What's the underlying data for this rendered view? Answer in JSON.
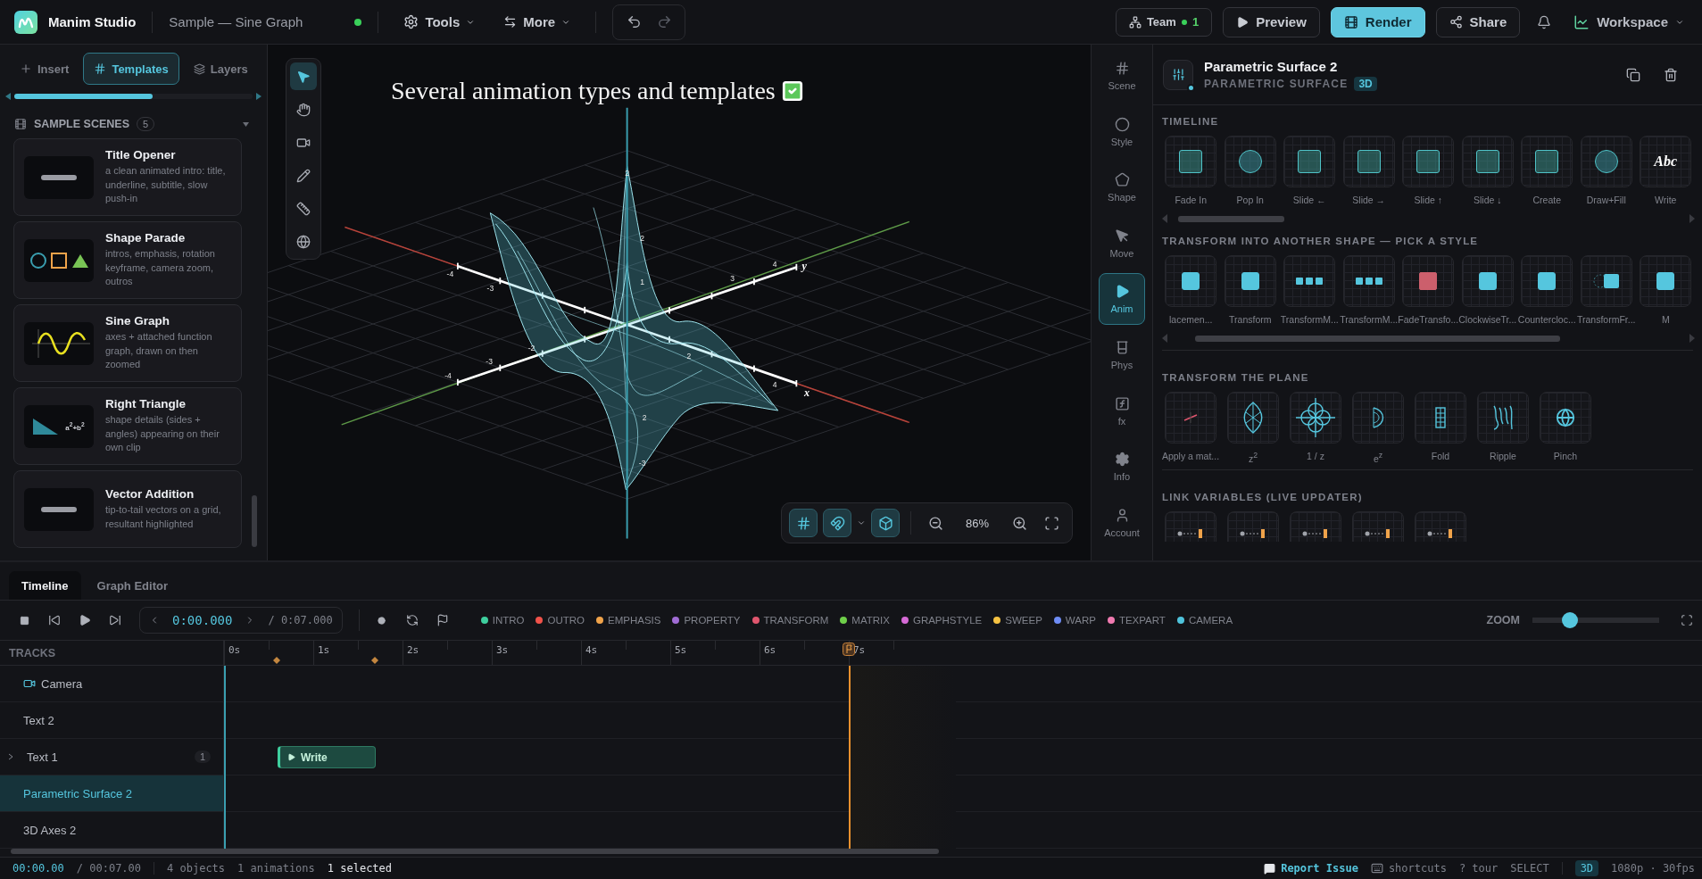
{
  "app": {
    "name": "Manim Studio",
    "project": "Sample — Sine Graph",
    "saved": true
  },
  "toolbar": {
    "menus": [
      {
        "label": "Tools",
        "kind": "gear"
      },
      {
        "label": "More",
        "kind": "swap"
      }
    ],
    "undo_disabled": false,
    "redo_disabled": true
  },
  "top_actions": {
    "team": {
      "label": "Team",
      "count": "1"
    },
    "buttons": [
      {
        "label": "Preview",
        "kind": "preview"
      },
      {
        "label": "Render",
        "kind": "render"
      },
      {
        "label": "Share",
        "kind": "share"
      }
    ],
    "workspace": "Workspace"
  },
  "left_panel": {
    "tabs": [
      {
        "label": "Insert",
        "kind": "insert",
        "selected": false
      },
      {
        "label": "Templates",
        "kind": "templates",
        "selected": true
      },
      {
        "label": "Layers",
        "kind": "layers",
        "selected": false
      }
    ],
    "section": {
      "title": "SAMPLE SCENES",
      "count": "5",
      "expanded": true
    },
    "scenes": [
      {
        "title": "Title Opener",
        "description": "a clean animated intro: title, underline, subtitle, slow push-in",
        "kind": "bar"
      },
      {
        "title": "Shape Parade",
        "description": "intros, emphasis, rotation keyframe, camera zoom, outros",
        "kind": "shapes"
      },
      {
        "title": "Sine Graph",
        "description": "axes + attached function graph, drawn on then zoomed",
        "kind": "sine"
      },
      {
        "title": "Right Triangle",
        "description": "shape details (sides + angles) appearing on their own clip",
        "kind": "triangle",
        "thumb_text": "a$^{2}$+b$^{2}$"
      },
      {
        "title": "Vector Addition",
        "description": "tip-to-tail vectors on a grid, resultant highlighted",
        "kind": "bar"
      }
    ]
  },
  "viewport": {
    "heading": "Several animation types and templates",
    "tools": [
      {
        "kind": "pointer",
        "selected": true
      },
      {
        "kind": "hand",
        "selected": false
      },
      {
        "kind": "camera",
        "selected": false
      },
      {
        "kind": "pen",
        "selected": false
      },
      {
        "kind": "ruler",
        "selected": false
      },
      {
        "kind": "globe",
        "selected": false
      }
    ],
    "tick_labels": [
      "-4",
      "-3",
      "-4",
      "-3",
      "-2",
      "2",
      "3",
      "4",
      "4",
      "2",
      "2",
      "1",
      "2",
      "-3"
    ],
    "axis_labels": [
      "y",
      "x"
    ],
    "view_toggles": [
      {
        "kind": "grid",
        "on": true
      },
      {
        "kind": "snap",
        "on": true
      },
      {
        "kind": "cube",
        "on": true
      }
    ],
    "zoom": "86%"
  },
  "rail": [
    {
      "label": "Scene",
      "kind": "scene",
      "selected": false
    },
    {
      "label": "Style",
      "kind": "style",
      "selected": false
    },
    {
      "label": "Shape",
      "kind": "shape",
      "selected": false
    },
    {
      "label": "Move",
      "kind": "move",
      "selected": false
    },
    {
      "label": "Anim",
      "kind": "anim",
      "selected": true
    },
    {
      "label": "Phys",
      "kind": "phys",
      "selected": false
    },
    {
      "label": "fx",
      "kind": "fx",
      "selected": false
    },
    {
      "label": "Info",
      "kind": "info",
      "selected": false
    },
    {
      "label": "Account",
      "kind": "account",
      "selected": false
    }
  ],
  "inspector": {
    "title": "Parametric Surface 2",
    "type": "PARAMETRIC SURFACE",
    "badge": "3D",
    "sections": [
      {
        "title": "TIMELINE",
        "kind": "scroll",
        "tiles": [
          {
            "label": "Fade In",
            "kind": "square"
          },
          {
            "label": "Pop In",
            "kind": "circle"
          },
          {
            "label": "Slide ←",
            "kind": "square"
          },
          {
            "label": "Slide →",
            "kind": "square"
          },
          {
            "label": "Slide ↑",
            "kind": "square"
          },
          {
            "label": "Slide ↓",
            "kind": "square"
          },
          {
            "label": "Create",
            "kind": "square"
          },
          {
            "label": "Draw+Fill",
            "kind": "circle"
          },
          {
            "label": "Write",
            "kind": "text",
            "glyph": "Abc"
          }
        ]
      },
      {
        "title": "TRANSFORM INTO ANOTHER SHAPE — PICK A STYLE",
        "kind": "scroll",
        "tiles": [
          {
            "label": "lacemen...",
            "kind": "solid"
          },
          {
            "label": "Transform",
            "kind": "solid"
          },
          {
            "label": "TransformM...",
            "kind": "triple"
          },
          {
            "label": "TransformM...",
            "kind": "triple"
          },
          {
            "label": "FadeTransfo...",
            "kind": "fade"
          },
          {
            "label": "ClockwiseTr...",
            "kind": "solid"
          },
          {
            "label": "Countercloc...",
            "kind": "solid"
          },
          {
            "label": "TransformFr...",
            "kind": "ghost"
          },
          {
            "label": "M",
            "kind": "solid"
          }
        ]
      },
      {
        "title": "TRANSFORM THE PLANE",
        "kind": "plain",
        "tiles": [
          {
            "label": "Apply a mat...",
            "kind": "matrix"
          },
          {
            "label": "z$^{2}$",
            "kind": "lens"
          },
          {
            "label": "1 / z",
            "kind": "flower"
          },
          {
            "label": "e$^{z}$",
            "kind": "half"
          },
          {
            "label": "Fold",
            "kind": "fold"
          },
          {
            "label": "Ripple",
            "kind": "ripple"
          },
          {
            "label": "Pinch",
            "kind": "globe"
          }
        ]
      },
      {
        "title": "LINK VARIABLES (LIVE UPDATER)",
        "kind": "peek",
        "tiles": [
          {
            "kind": "link"
          },
          {
            "kind": "link"
          },
          {
            "kind": "link"
          },
          {
            "kind": "link"
          },
          {
            "kind": "link"
          }
        ]
      }
    ]
  },
  "timeline": {
    "tabs": [
      {
        "label": "Timeline",
        "selected": true
      },
      {
        "label": "Graph Editor",
        "selected": false
      }
    ],
    "time": "0:00.000",
    "duration": "/ 0:07.000",
    "legend": [
      {
        "label": "INTRO",
        "color": "#3ecf9e"
      },
      {
        "label": "OUTRO",
        "color": "#f0524a"
      },
      {
        "label": "EMPHASIS",
        "color": "#f0a34a"
      },
      {
        "label": "PROPERTY",
        "color": "#a06cd5"
      },
      {
        "label": "TRANSFORM",
        "color": "#e0566e"
      },
      {
        "label": "MATRIX",
        "color": "#6fcf4a"
      },
      {
        "label": "GRAPHSTYLE",
        "color": "#d66ad6"
      },
      {
        "label": "SWEEP",
        "color": "#f5c242"
      },
      {
        "label": "WARP",
        "color": "#6e8cf5"
      },
      {
        "label": "TEXPART",
        "color": "#f07ab0"
      },
      {
        "label": "CAMERA",
        "color": "#4fc3dc"
      }
    ],
    "zoom": {
      "label": "ZOOM",
      "level": 0.27
    },
    "tracks_header": "TRACKS",
    "ruler": [
      "0s",
      "1s",
      "2s",
      "3s",
      "4s",
      "5s",
      "6s",
      "7s"
    ],
    "tracks": [
      {
        "name": "Camera",
        "kind": "camera",
        "selected": false
      },
      {
        "name": "Text 2",
        "kind": "object",
        "selected": false
      },
      {
        "name": "Text 1",
        "kind": "group",
        "selected": false,
        "expanded": false,
        "count": "1",
        "clips": [
          {
            "label": "Write"
          }
        ]
      },
      {
        "name": "Parametric Surface 2",
        "kind": "object",
        "selected": true
      },
      {
        "name": "3D Axes 2",
        "kind": "object",
        "selected": false
      }
    ]
  },
  "status_bar": {
    "time": "00:00.00",
    "total": "/ 00:07.00",
    "stats": [
      {
        "text": "4 objects",
        "emphasis": false
      },
      {
        "text": "1 animations",
        "emphasis": false
      },
      {
        "text": "1 selected",
        "emphasis": true
      }
    ],
    "report": "Report Issue",
    "shortcuts": "shortcuts",
    "tour": "? tour",
    "mode": "SELECT",
    "badge": "3D",
    "format": "1080p · 30fps"
  }
}
